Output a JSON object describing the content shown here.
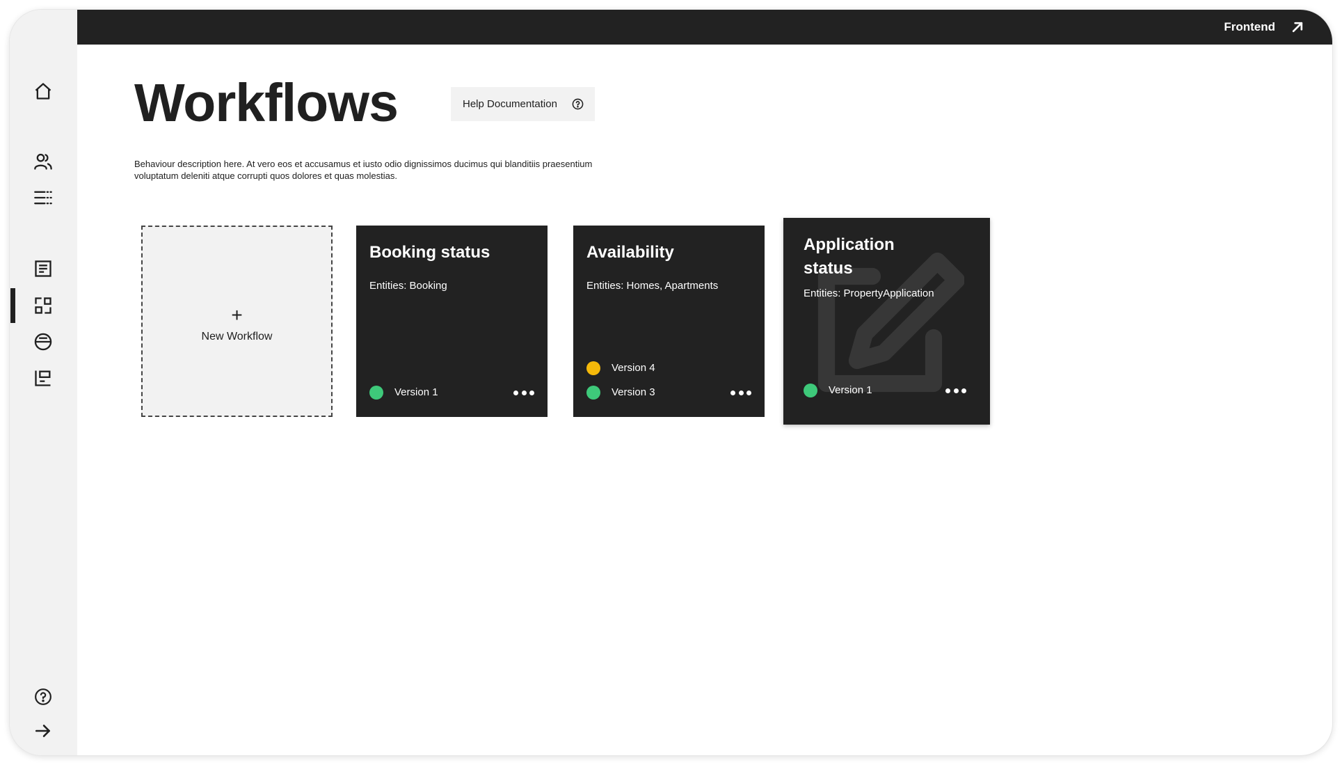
{
  "topbar": {
    "frontend_label": "Frontend"
  },
  "sidebar": {
    "items": [
      {
        "name": "home",
        "icon": "home-icon"
      },
      {
        "name": "users",
        "icon": "users-icon"
      },
      {
        "name": "list",
        "icon": "list-icon"
      },
      {
        "name": "documents",
        "icon": "document-icon"
      },
      {
        "name": "workflows",
        "icon": "workflow-icon",
        "active": true
      },
      {
        "name": "integrations",
        "icon": "circle-divider-icon"
      },
      {
        "name": "dashboard",
        "icon": "chart-icon"
      },
      {
        "name": "help",
        "icon": "help-icon"
      },
      {
        "name": "collapse",
        "icon": "arrow-right-icon"
      }
    ]
  },
  "page": {
    "title": "Workflows",
    "help_label": "Help Documentation",
    "description_line1": "Behaviour description here. At vero eos et accusamus et iusto odio dignissimos ducimus qui blanditiis praesentium",
    "description_line2": "voluptatum deleniti atque corrupti quos dolores et quas molestias."
  },
  "new_workflow": {
    "plus": "+",
    "label": "New Workflow"
  },
  "workflows": [
    {
      "title": "Booking status",
      "entities": "Entities: Booking",
      "versions": [
        {
          "label": "Version 1",
          "status_color": "#3ec97a"
        }
      ]
    },
    {
      "title": "Availability",
      "entities": "Entities: Homes, Apartments",
      "versions": [
        {
          "label": "Version 4",
          "status_color": "#f5b90a"
        },
        {
          "label": "Version 3",
          "status_color": "#3ec97a"
        }
      ]
    },
    {
      "title_line1": "Application",
      "title_line2": "status",
      "entities": "Entities: PropertyApplication",
      "versions": [
        {
          "label": "Version 1",
          "status_color": "#3ec97a"
        }
      ],
      "hover_icon": "edit-icon"
    }
  ],
  "colors": {
    "dark": "#222222",
    "sidebar_bg": "#f2f2f2",
    "status_green": "#3ec97a",
    "status_yellow": "#f5b90a"
  }
}
